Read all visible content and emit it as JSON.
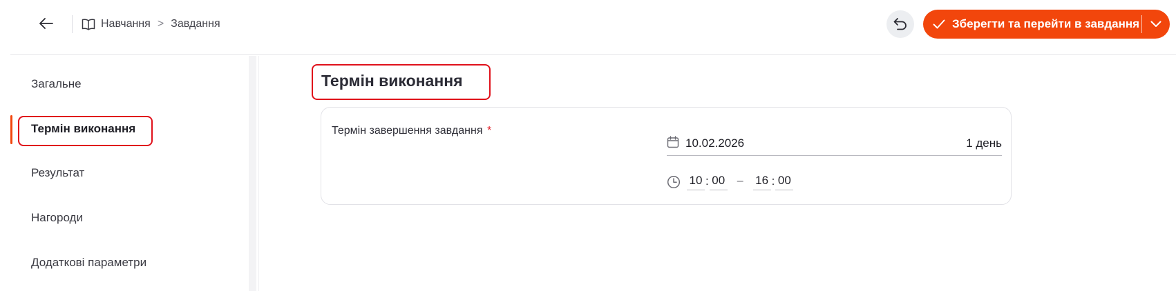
{
  "header": {
    "breadcrumb": [
      {
        "label": "Навчання",
        "icon": "book-icon"
      },
      {
        "label": "Завдання"
      }
    ],
    "breadcrumb_separator": ">",
    "save_button_label": "Зберегти та перейти в завдання",
    "accent_color": "#f2460c"
  },
  "sidebar": {
    "items": [
      {
        "label": "Загальне"
      },
      {
        "label": "Термін виконання",
        "active": true
      },
      {
        "label": "Результат"
      },
      {
        "label": "Нагороди"
      },
      {
        "label": "Додаткові параметри"
      }
    ]
  },
  "main": {
    "section_title": "Термін виконання",
    "deadline": {
      "label": "Термін завершення завдання",
      "required_mark": "*",
      "date": "10.02.2026",
      "duration": "1 день",
      "time_from": {
        "hours": "10",
        "minutes": "00"
      },
      "time_to": {
        "hours": "16",
        "minutes": "00"
      },
      "time_separator": ":",
      "range_dash": "–"
    }
  },
  "highlight_color": "#e0101a"
}
